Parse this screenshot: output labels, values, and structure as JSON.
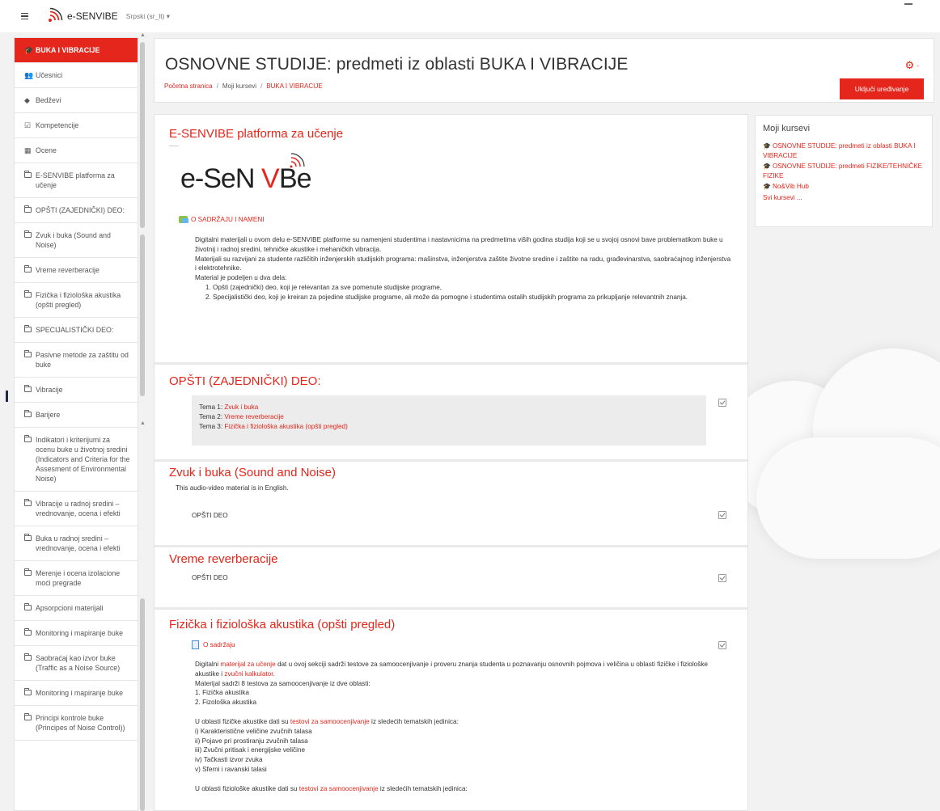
{
  "navbar": {
    "brand": "e-SENVIBE",
    "language": "Srpski (sr_lt) ▾"
  },
  "drawer": {
    "items": [
      {
        "label": "BUKA I VIBRACIJE",
        "icon": "graduation-cap-icon",
        "active": true
      },
      {
        "label": "Učesnici",
        "icon": "users-icon"
      },
      {
        "label": "Bedževi",
        "icon": "shield-icon"
      },
      {
        "label": "Kompetencije",
        "icon": "checkbox-icon"
      },
      {
        "label": "Ocene",
        "icon": "table-icon"
      },
      {
        "label": "E-SENVIBE platforma za učenje",
        "icon": "folder-icon"
      },
      {
        "label": "OPŠTI (ZAJEDNIČKI) DEO:",
        "icon": "folder-icon"
      },
      {
        "label": "Zvuk i buka (Sound and Noise)",
        "icon": "folder-icon"
      },
      {
        "label": "Vreme reverberacije",
        "icon": "folder-icon"
      },
      {
        "label": "Fizička i fiziološka akustika (opšti pregled)",
        "icon": "folder-icon"
      },
      {
        "label": "SPECIJALISTIČKI DEO:",
        "icon": "folder-icon"
      },
      {
        "label": "Pasivne metode za zaštitu od buke",
        "icon": "folder-icon"
      },
      {
        "label": "Vibracije",
        "icon": "folder-icon"
      },
      {
        "label": "Barijere",
        "icon": "folder-icon"
      },
      {
        "label": "Indikatori i kriterijumi za ocenu buke u životnoj sredini (Indicators and Criteria for the Assesment of Environmental Noise)",
        "icon": "folder-icon"
      },
      {
        "label": "Vibracije u radnoj sredini – vrednovanje, ocena i efekti",
        "icon": "folder-icon"
      },
      {
        "label": "Buka u radnoj sredini – vrednovanje, ocena i efekti",
        "icon": "folder-icon"
      },
      {
        "label": "Merenje i ocena izolacione moći pregrade",
        "icon": "folder-icon"
      },
      {
        "label": "Apsorpcioni materijali",
        "icon": "folder-icon"
      },
      {
        "label": "Monitoring i mapiranje buke",
        "icon": "folder-icon"
      },
      {
        "label": "Saobraćaj kao izvor buke (Traffic as a Noise Source)",
        "icon": "folder-icon"
      },
      {
        "label": "Monitoring i mapiranje buke",
        "icon": "folder-icon"
      },
      {
        "label": "Principi kontrole buke (Principes of Noise Control))",
        "icon": "folder-icon"
      }
    ]
  },
  "header": {
    "title": "OSNOVNE STUDIJE: predmeti iz oblasti BUKA I VIBRACIJE",
    "breadcrumb": [
      "Početna stranica",
      "Moji kursevi",
      "BUKA I VIBRACIJE"
    ],
    "edit_button": "Uključi uređivanje",
    "gear_caret": "-"
  },
  "sections": {
    "intro": {
      "title": "E-SENVIBE platforma za učenje",
      "logo_text": "e-SeNVBe",
      "about_link": "O SADRŽAJU I NAMENI",
      "p1": "Digitalni materijali u ovom delu e-SENVIBE platforme su namenjeni studentima i nastavnicima na predmetima viših godina studija koji se u svojoj osnovi bave problematikom buke u životnij i radnoj sredini, tehničke akustike i mehaničkih vibracija.",
      "p2": "Materijali su razvijani za studente različitih inženjerskih studijskih programa: mašinstva, inženjerstva zaštite životne sredine i zaštite na radu, građevinarstva, saobraćajnog inženjerstva i elektrotehnike.",
      "p3": "Material je podeljen u dva dela:",
      "list": [
        "Opšti (zajednički) deo, koji je relevantan za sve pomenute studijske programe,",
        "Specijalistički deo, koji je kreiran za pojedine studijske programe, ali može da pomogne i studentima ostalih studijskih programa za prikupljanje relevantnih znanja."
      ]
    },
    "general": {
      "title": "OPŠTI (ZAJEDNIČKI) DEO:",
      "topics": [
        {
          "prefix": "Tema 1: ",
          "link": "Zvuk i buka"
        },
        {
          "prefix": "Tema 2: ",
          "link": "Vreme reverberacije"
        },
        {
          "prefix": "Tema 3: ",
          "link": "Fizička i fiziološka akustika (opšti pregled)"
        }
      ]
    },
    "sound": {
      "title": "Zvuk i buka (Sound and Noise)",
      "summary": "This audio-video material is in English.",
      "item": "OPŠTI DEO"
    },
    "reverb": {
      "title": "Vreme reverberacije",
      "item": "OPŠTI DEO"
    },
    "acoustics": {
      "title": "Fizička i fiziološka akustika (opšti pregled)",
      "resource": "O sadržaju",
      "p1_a": "Digitalni ",
      "p1_link1": "materijal za učenje",
      "p1_b": " dat u ovoj sekciji sadrži testove za samoocenjivanje i proveru znanja studenta u poznavanju osnovnih pojmova i veličina u oblasti fizičke i fiziološke akustike i ",
      "p1_link2": "zvučni kalkulator",
      "p1_c": ".",
      "p2": "Materijal sadrži 8 testova za samoocenjivanje iz dve oblasti:",
      "p2_items": [
        "1. Fizička akustika",
        "2. Fizološka akustika"
      ],
      "p3_a": "U oblasti fizičke akustike dati su ",
      "p3_link": "testovi za samoocenjivanje",
      "p3_b": " iz sledećih tematskih jedinica:",
      "p3_items": [
        "i) Karakteristične veličine zvučnih talasa",
        "ii) Pojave pri prostiranju zvučnih talasa",
        "iii) Zvučni pritisak i energijske veličine",
        "iv) Tačkasti izvor zvuka",
        "v) Sferni i ravanski talasi"
      ],
      "p4_a": "U oblasti fiziološke akustike dati su ",
      "p4_link": "testovi za samoocenjivanje",
      "p4_b": " iz sledećih tematskih jedinica:"
    }
  },
  "block": {
    "title": "Moji kursevi",
    "courses": [
      "OSNOVNE STUDIJE: predmeti iz oblasti BUKA I VIBRACIJE",
      "OSNOVNE STUDIJE: predmeti FIZIKE/TEHNIČKE FIZIKE",
      "No&Vib Hub"
    ],
    "all": "Svi kursevi ..."
  },
  "colors": {
    "accent": "#e4261c",
    "background": "#f2f2f2",
    "card": "#ffffff"
  }
}
